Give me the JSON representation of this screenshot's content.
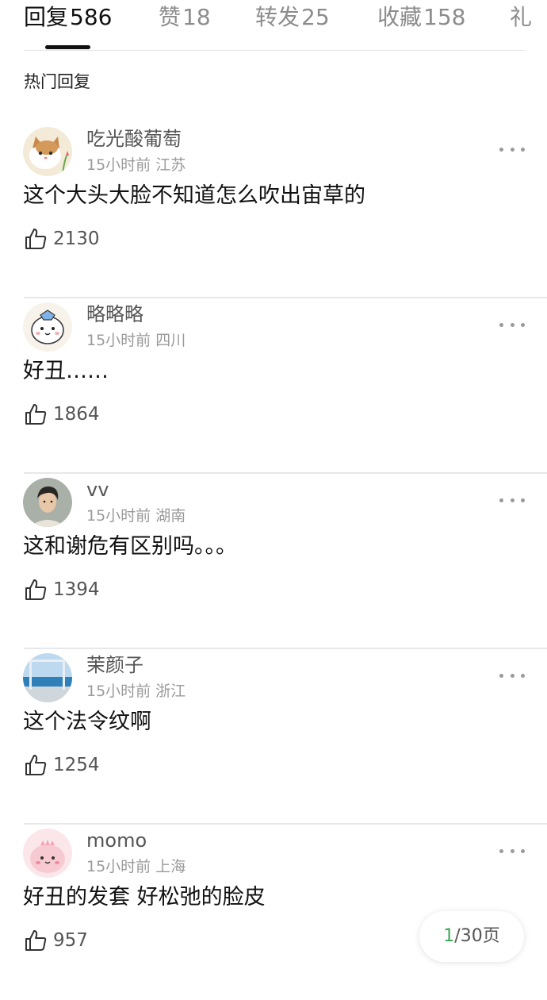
{
  "tabs": [
    {
      "label": "回复",
      "count": "586"
    },
    {
      "label": "赞",
      "count": "18"
    },
    {
      "label": "转发",
      "count": "25"
    },
    {
      "label": "收藏",
      "count": "158"
    },
    {
      "label": "礼",
      "count": ""
    }
  ],
  "section_title": "热门回复",
  "comments": [
    {
      "user": "吃光酸葡萄",
      "time": "15小时前",
      "location": "江苏",
      "text": "这个大头大脸不知道怎么吹出宙草的",
      "likes": "2130",
      "avatar": "cat-avatar"
    },
    {
      "user": "略略略",
      "time": "15小时前",
      "location": "四川",
      "text": "好丑……",
      "likes": "1864",
      "avatar": "cartoon-avatar"
    },
    {
      "user": "vv",
      "time": "15小时前",
      "location": "湖南",
      "text": "这和谢危有区别吗。。。",
      "likes": "1394",
      "avatar": "portrait-avatar"
    },
    {
      "user": "茉颜子",
      "time": "15小时前",
      "location": "浙江",
      "text": "这个法令纹啊",
      "likes": "1254",
      "avatar": "seaside-avatar"
    },
    {
      "user": "momo",
      "time": "15小时前",
      "location": "上海",
      "text": "好丑的发套 好松弛的脸皮",
      "likes": "957",
      "avatar": "pink-dino-avatar"
    }
  ],
  "pagination": {
    "current": "1",
    "rest": "/30页"
  },
  "colors": {
    "accent_green": "#3aa757",
    "text_gray": "#9a9a9a"
  }
}
